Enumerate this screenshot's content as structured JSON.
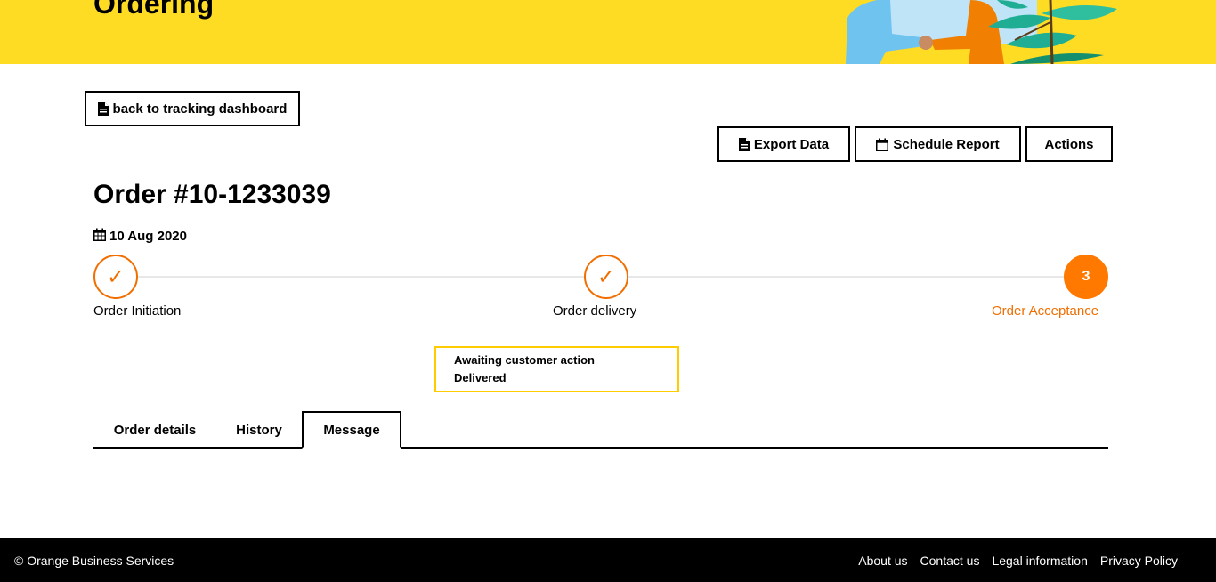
{
  "hero": {
    "title": "Ordering"
  },
  "nav": {
    "back_label": "back to tracking dashboard"
  },
  "toolbar": {
    "export_label": "Export Data",
    "schedule_label": "Schedule Report",
    "actions_label": "Actions"
  },
  "order": {
    "title": "Order #10-1233039",
    "date": "10 Aug 2020"
  },
  "stepper": {
    "steps": [
      {
        "label": "Order Initiation",
        "mark": "✓",
        "state": "completed"
      },
      {
        "label": "Order delivery",
        "mark": "✓",
        "state": "completed"
      },
      {
        "label": "Order Acceptance",
        "mark": "3",
        "state": "active"
      }
    ]
  },
  "status": {
    "line1": "Awaiting customer action",
    "line2": "Delivered"
  },
  "tabs": [
    {
      "label": "Order details"
    },
    {
      "label": "History"
    },
    {
      "label": "Message",
      "selected": true
    }
  ],
  "footer": {
    "copyright": "© Orange Business Services",
    "links": [
      "About us",
      "Contact us",
      "Legal information",
      "Privacy Policy"
    ]
  },
  "colors": {
    "brand_yellow": "#ffdc24",
    "brand_orange": "#ff7900",
    "status_border": "#ffcc00"
  },
  "icons": {
    "export": "file-text-icon",
    "back": "file-text-icon",
    "schedule": "calendar-icon",
    "date": "calendar-icon"
  }
}
